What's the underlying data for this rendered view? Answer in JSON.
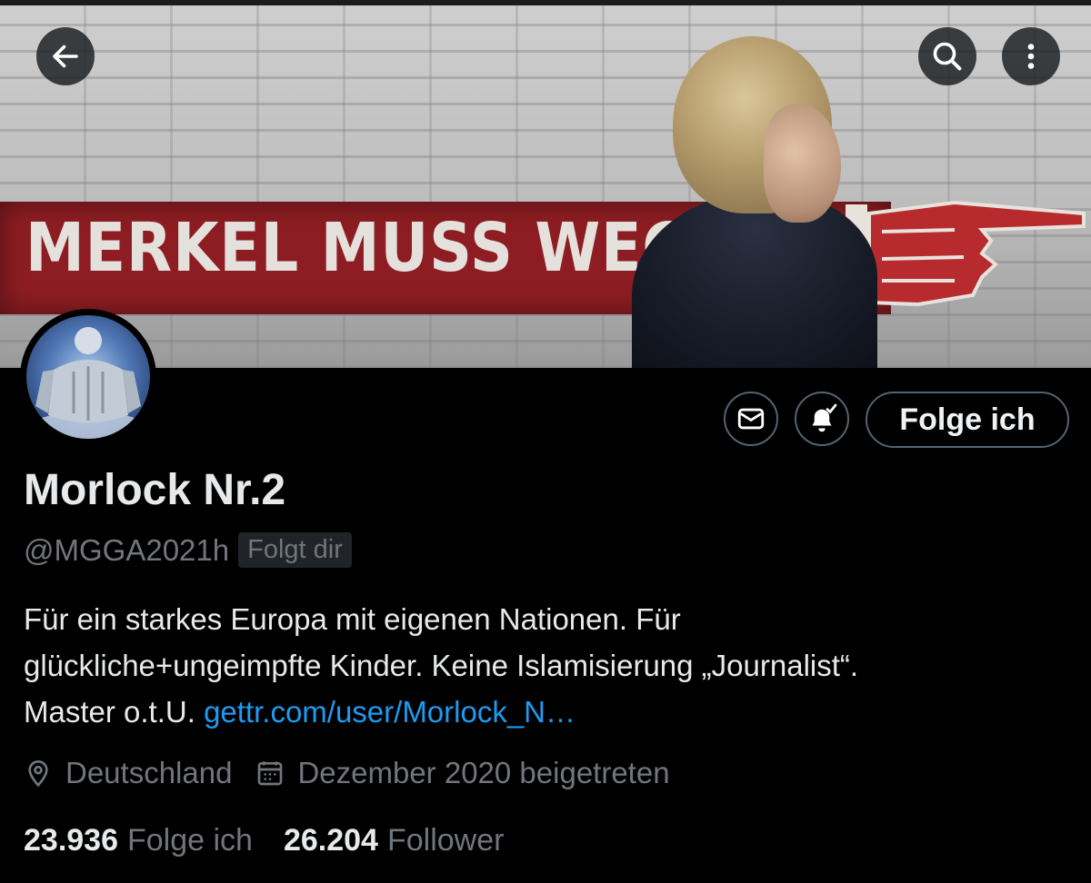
{
  "header": {
    "back_icon": "arrow-left-icon",
    "search_icon": "search-icon",
    "more_icon": "more-vertical-icon"
  },
  "banner": {
    "sign_text": "MERKEL MUSS WEG"
  },
  "actions": {
    "message_icon": "envelope-icon",
    "notify_icon": "bell-check-icon",
    "follow_label": "Folge ich"
  },
  "profile": {
    "name": "Morlock Nr.2",
    "handle": "@MGGA2021h",
    "follows_you": "Folgt dir",
    "bio_lines": [
      "Für ein starkes Europa mit eigenen Nationen. Für",
      "glückliche+ungeimpfte Kinder. Keine Islamisierung „Journalist“.",
      "Master o.t.U. "
    ],
    "bio_link": "gettr.com/user/Morlock_N…",
    "location": "Deutschland",
    "joined": "Dezember 2020 beigetreten"
  },
  "stats": {
    "following_count": "23.936",
    "following_label": "Folge ich",
    "followers_count": "26.204",
    "followers_label": "Follower"
  },
  "colors": {
    "background": "#000000",
    "link": "#1d9bf0",
    "secondary_text": "#71767b",
    "border": "#536471"
  }
}
